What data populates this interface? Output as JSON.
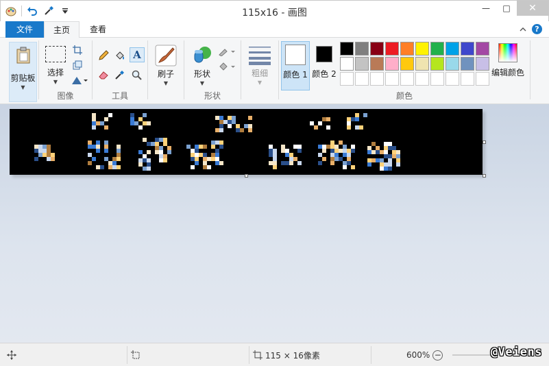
{
  "window": {
    "title": "115x16 - 画图",
    "minimize_glyph": "—",
    "maximize_glyph": "□",
    "close_glyph": "✕"
  },
  "tabs": [
    {
      "label": "文件"
    },
    {
      "label": "主页"
    },
    {
      "label": "查看"
    }
  ],
  "ribbon": {
    "clipboard": {
      "label": "剪贴板"
    },
    "image": {
      "label": "图像",
      "select": "选择"
    },
    "tools": {
      "label": "工具"
    },
    "brush": {
      "label": "刷子"
    },
    "shapes": {
      "label": "形状",
      "shape_btn": "形状"
    },
    "size": {
      "label": "粗细"
    },
    "colors": {
      "label": "颜色",
      "color1": "颜色 1",
      "color2": "颜色 2",
      "edit": "编辑颜色",
      "color1_value": "#ffffff",
      "color2_value": "#000000",
      "palette": [
        "#000000",
        "#7f7f7f",
        "#880015",
        "#ed1c24",
        "#ff7f27",
        "#fff200",
        "#22b14c",
        "#00a2e8",
        "#3f48cc",
        "#a349a4",
        "#ffffff",
        "#c3c3c3",
        "#b97a57",
        "#ffaec9",
        "#ffc90e",
        "#efe4b0",
        "#b5e61d",
        "#99d9ea",
        "#7092be",
        "#c8bfe7",
        "",
        "",
        "",
        "",
        "",
        "",
        "",
        "",
        "",
        ""
      ]
    }
  },
  "statusbar": {
    "image_size": "115 × 16像素",
    "zoom": "600%",
    "watermark": "@Veiens"
  }
}
